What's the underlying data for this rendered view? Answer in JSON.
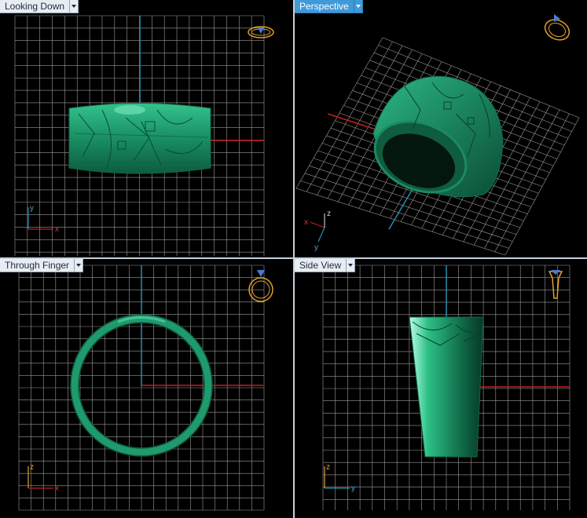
{
  "viewports": {
    "top_left": {
      "title": "Looking Down"
    },
    "top_right": {
      "title": "Perspective",
      "active": true
    },
    "bottom_left": {
      "title": "Through Finger"
    },
    "bottom_right": {
      "title": "Side View"
    }
  },
  "axis_labels": {
    "looking_down": {
      "vertical": "y",
      "horizontal": "x"
    },
    "perspective": {
      "a": "x",
      "b": "z",
      "c": "y"
    },
    "through_finger": {
      "vertical": "z",
      "horizontal": "x"
    },
    "side_view": {
      "vertical": "z",
      "horizontal": "y"
    }
  },
  "colors": {
    "background": "#000000",
    "grid": "#9a9a9a",
    "ring": "#1f9a6c",
    "axis_red": "#c81e1e",
    "axis_blue": "#2a8db0",
    "nav_icon": "#e0a030",
    "active_tab": "#3e9ad9"
  },
  "icons": {
    "view_cube": "ring-orientation-icon",
    "dropdown": "chevron-down-icon"
  }
}
